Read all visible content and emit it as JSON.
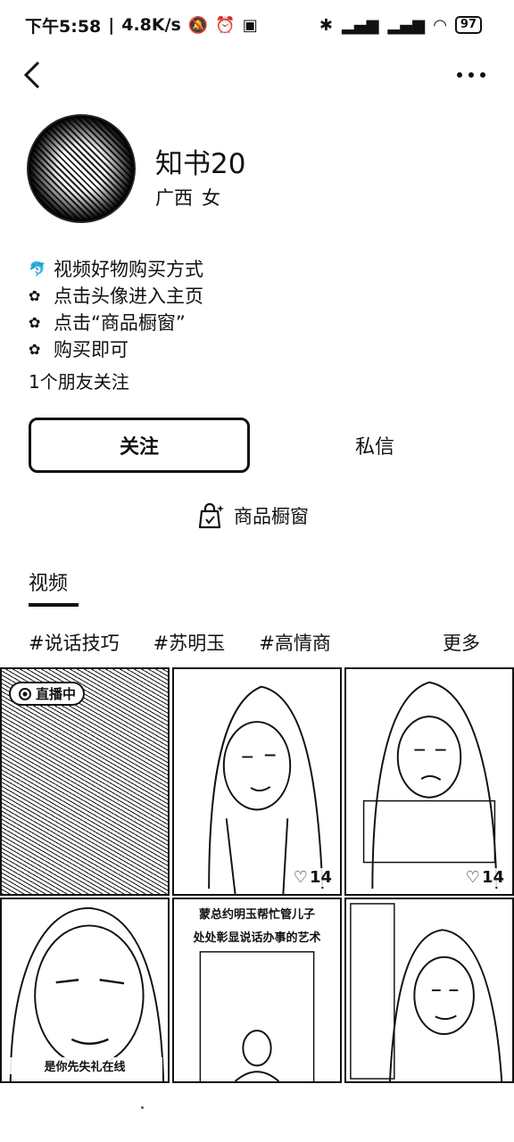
{
  "status_bar": {
    "time": "下午5:58",
    "net_speed": "4.8K/s",
    "battery": "97"
  },
  "profile": {
    "name": "知书20",
    "region": "广西",
    "gender": "女",
    "bio_lines": [
      "视频好物购买方式",
      "点击头像进入主页",
      "点击“商品橱窗”",
      "购买即可"
    ],
    "followers_text": "1个朋友关注"
  },
  "actions": {
    "follow": "关注",
    "message": "私信",
    "shop": "商品橱窗"
  },
  "tabs": [
    {
      "label": "视频",
      "active": true
    }
  ],
  "hashtags": [
    "#说话技巧",
    "#苏明玉",
    "#高情商"
  ],
  "more_label": "更多",
  "videos": [
    {
      "badge": "直播中"
    },
    {
      "likes": "14"
    },
    {
      "likes": "14"
    },
    {
      "caption": "是你先失礼在线"
    },
    {
      "caption_lines": [
        "蒙总约明玉帮忙管儿子",
        "处处彰显说话办事的艺术"
      ]
    },
    {}
  ]
}
